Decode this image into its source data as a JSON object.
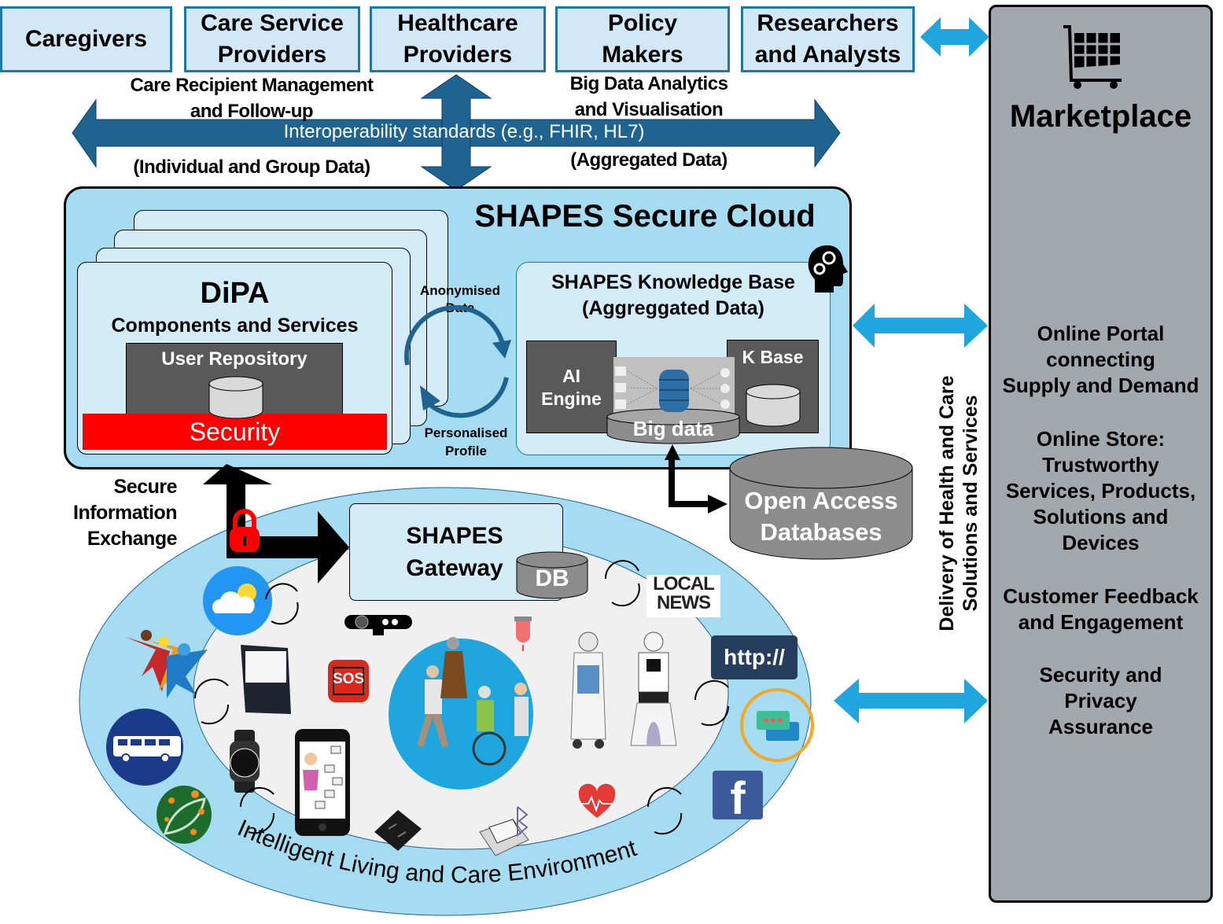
{
  "stakeholders": [
    {
      "label": "Caregivers"
    },
    {
      "label": "Care Service\nProviders"
    },
    {
      "label": "Healthcare\nProviders"
    },
    {
      "label": "Policy\nMakers"
    },
    {
      "label": "Researchers\nand Analysts"
    }
  ],
  "interop": {
    "left_top": "Care Recipient Management\nand Follow-up",
    "left_bottom": "(Individual and Group Data)",
    "right_top": "Big Data Analytics\nand Visualisation",
    "right_bottom": "(Aggregated Data)",
    "arrow_label": "Interoperability standards (e.g., FHIR, HL7)"
  },
  "cloud": {
    "title": "SHAPES Secure Cloud",
    "dipa": {
      "title": "DiPA",
      "subtitle": "Components and Services",
      "user_repository": "User Repository",
      "security": "Security"
    },
    "flow_top": "Anonymised\nData",
    "flow_bottom": "Personalised\nProfile",
    "knowledge_base": {
      "title": "SHAPES Knowledge Base\n(Aggreggated Data)",
      "ai_engine": "AI\nEngine",
      "big_data": "Big data",
      "k_base": "K Base"
    }
  },
  "open_access": "Open Access\nDatabases",
  "secure_exchange": "Secure\nInformation\nExchange",
  "gateway": {
    "title": "SHAPES\nGateway",
    "db": "DB"
  },
  "environment": {
    "label": "Intelligent Living and Care Environment",
    "local_news": [
      "LOCAL",
      "NEWS"
    ],
    "http": "http://",
    "sos": "SOS",
    "facebook": "f"
  },
  "delivery_label": "Delivery of Health and Care\nSolutions and Services",
  "marketplace": {
    "title": "Marketplace",
    "items": [
      "Online Portal\nconnecting\nSupply and Demand",
      "Online Store:\nTrustworthy\nServices, Products,\nSolutions and\nDevices",
      "Customer Feedback\nand Engagement",
      "Security and\nPrivacy\nAssurance"
    ]
  },
  "colors": {
    "stake_fill": "#d3e8f6",
    "stake_border": "#1f77a8",
    "dark_arrow": "#1f6391",
    "cyan_arrow": "#1fa6de",
    "cloud_fill": "#a6dcf2",
    "security_red": "#ff0000",
    "market_grey": "#a1a9ae"
  }
}
